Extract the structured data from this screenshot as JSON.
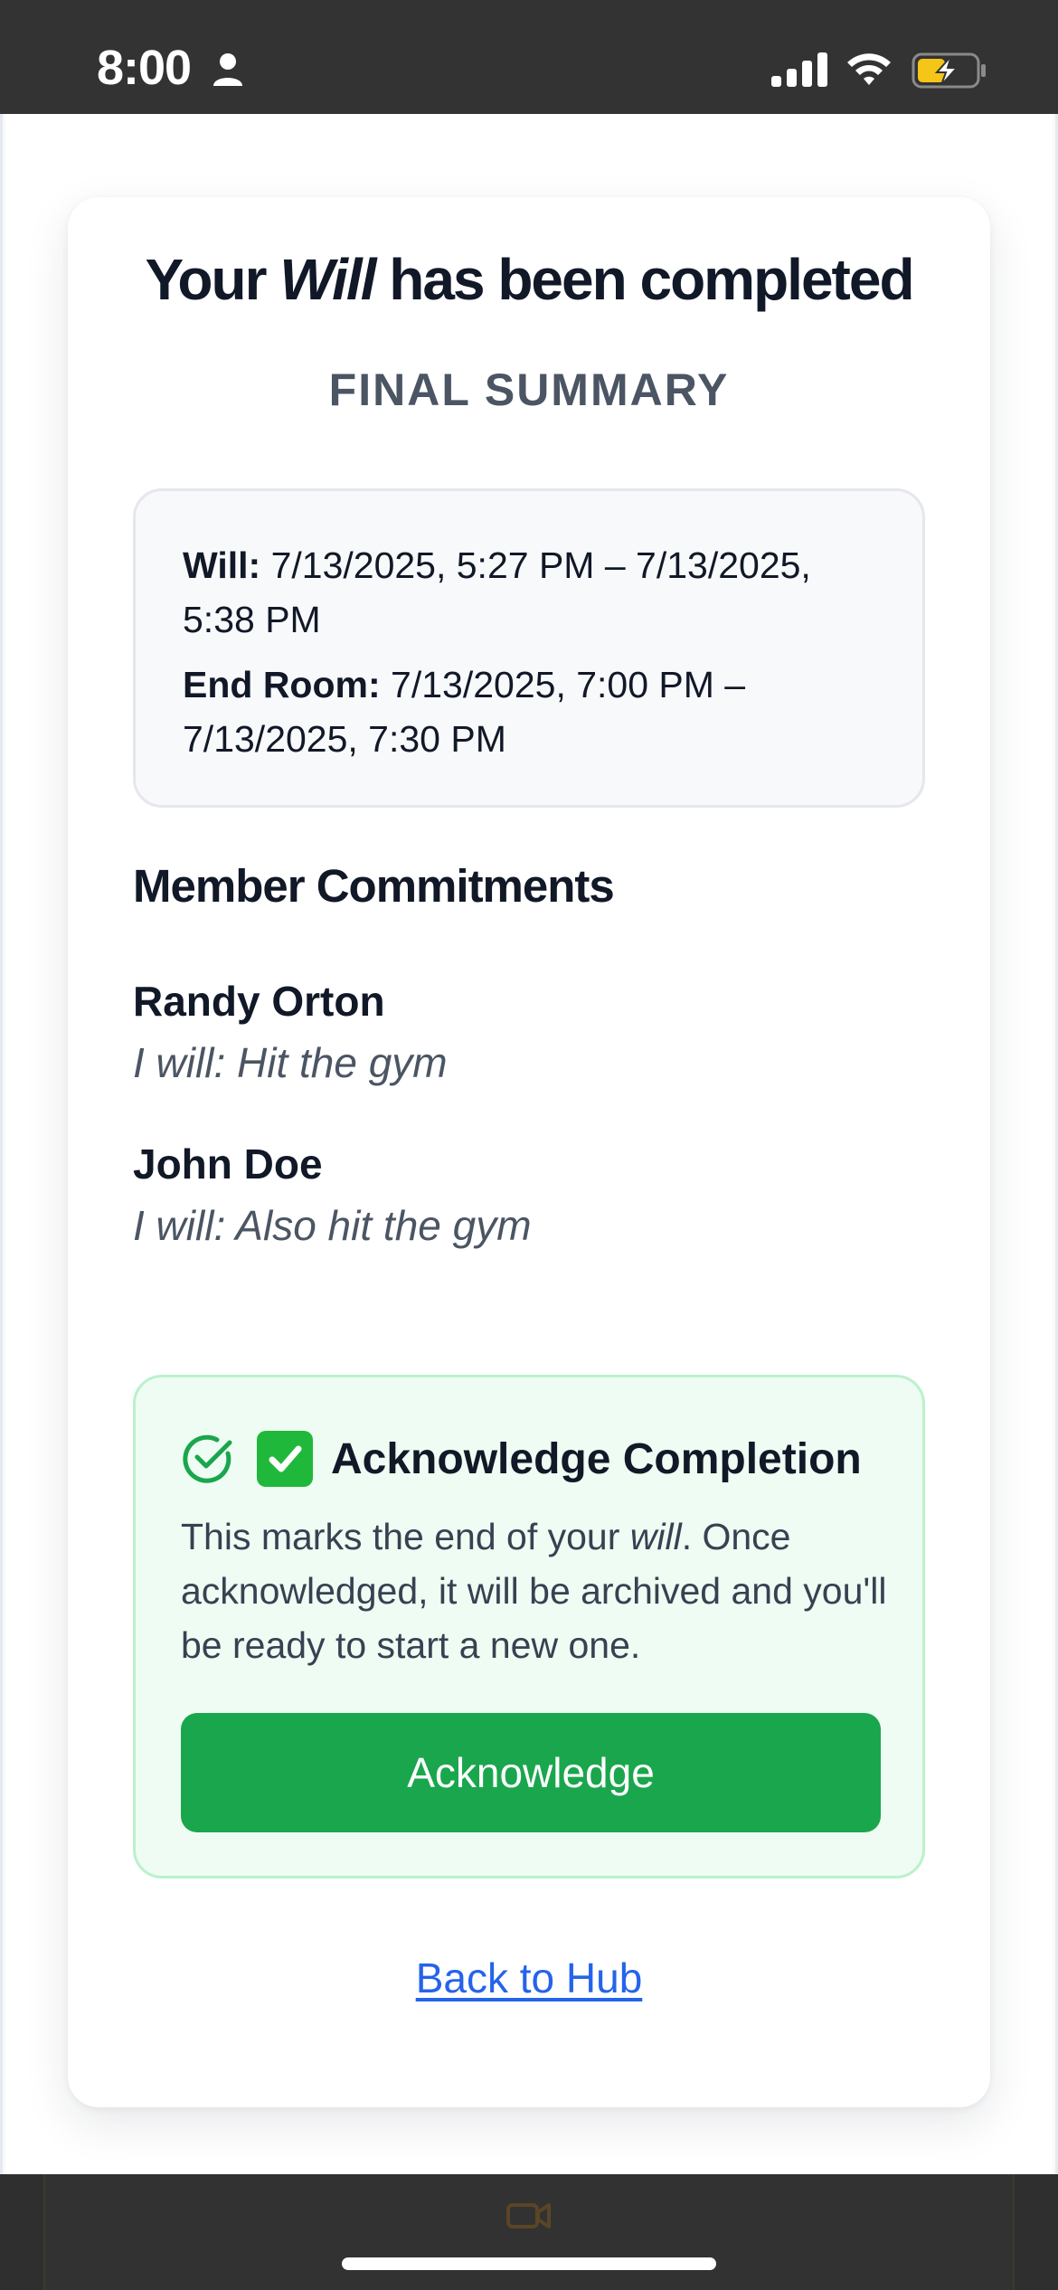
{
  "status_bar": {
    "time": "8:00",
    "icons": [
      "person-icon",
      "signal-icon",
      "wifi-icon",
      "battery-charging-icon"
    ]
  },
  "card": {
    "title_prefix": "Your ",
    "title_emphasis": "Will",
    "title_suffix": " has been completed",
    "subtitle": "FINAL SUMMARY",
    "dates": {
      "will_label": "Will:",
      "will_value": "7/13/2025, 5:27 PM – 7/13/2025, 5:38 PM",
      "end_room_label": "End Room:",
      "end_room_value": "7/13/2025, 7:00 PM – 7/13/2025, 7:30 PM"
    },
    "members_title": "Member Commitments",
    "members": [
      {
        "name": "Randy Orton",
        "commitment": "I will: Hit the gym"
      },
      {
        "name": "John Doe",
        "commitment": "I will: Also hit the gym"
      }
    ],
    "acknowledge": {
      "emoji": "✅",
      "title": "Acknowledge Completion",
      "text_before": "This marks the end of your ",
      "text_emphasis": "will",
      "text_after": ". Once acknowledged, it will be archived and you'll be ready to start a new one.",
      "button_label": "Acknowledge"
    },
    "back_link": "Back to Hub"
  },
  "colors": {
    "accent_green": "#1aa64d",
    "ack_background": "#effcf3",
    "link_blue": "#2563eb",
    "status_bar": "#333333"
  }
}
